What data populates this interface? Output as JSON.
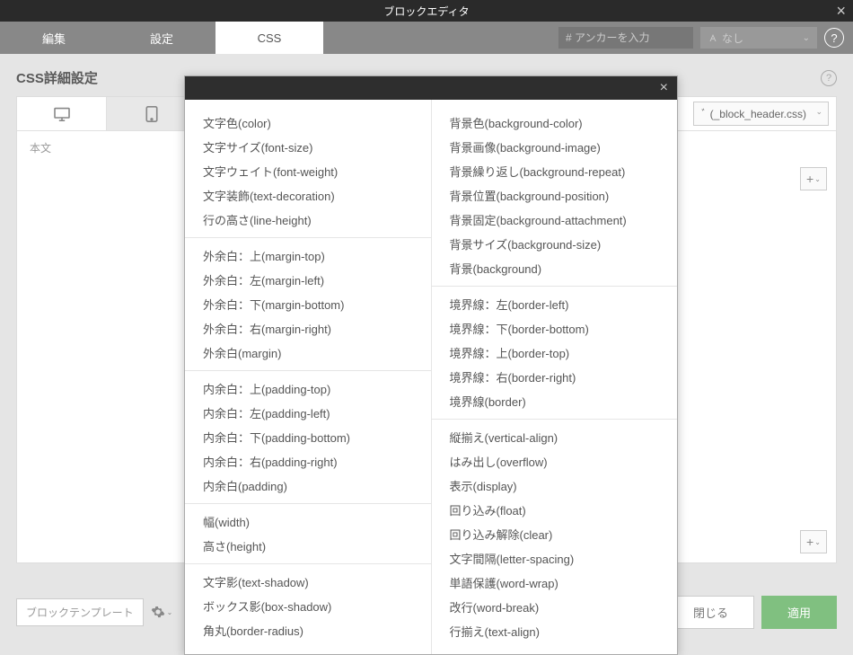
{
  "window": {
    "title": "ブロックエディタ"
  },
  "tabs": {
    "edit": "編集",
    "settings": "設定",
    "css": "CSS"
  },
  "anchor": {
    "placeholder": "# アンカーを入力"
  },
  "noneSelect": {
    "label": "なし"
  },
  "subheader": {
    "title": "CSS詳細設定"
  },
  "import": {
    "label": "ﾞ (_block_header.css)"
  },
  "body": {
    "label": "本文"
  },
  "footer": {
    "template": "ブロックテンプレート",
    "close": "閉じる",
    "apply": "適用"
  },
  "props": {
    "leftGroups": [
      [
        "文字色(color)",
        "文字サイズ(font-size)",
        "文字ウェイト(font-weight)",
        "文字装飾(text-decoration)",
        "行の高さ(line-height)"
      ],
      [
        "外余白：上(margin-top)",
        "外余白：左(margin-left)",
        "外余白：下(margin-bottom)",
        "外余白：右(margin-right)",
        "外余白(margin)"
      ],
      [
        "内余白：上(padding-top)",
        "内余白：左(padding-left)",
        "内余白：下(padding-bottom)",
        "内余白：右(padding-right)",
        "内余白(padding)"
      ],
      [
        "幅(width)",
        "高さ(height)"
      ],
      [
        "文字影(text-shadow)",
        "ボックス影(box-shadow)",
        "角丸(border-radius)"
      ]
    ],
    "rightGroups": [
      [
        "背景色(background-color)",
        "背景画像(background-image)",
        "背景繰り返し(background-repeat)",
        "背景位置(background-position)",
        "背景固定(background-attachment)",
        "背景サイズ(background-size)",
        "背景(background)"
      ],
      [
        "境界線：左(border-left)",
        "境界線：下(border-bottom)",
        "境界線：上(border-top)",
        "境界線：右(border-right)",
        "境界線(border)"
      ],
      [
        "縦揃え(vertical-align)",
        "はみ出し(overflow)",
        "表示(display)",
        "回り込み(float)",
        "回り込み解除(clear)",
        "文字間隔(letter-spacing)",
        "単語保護(word-wrap)",
        "改行(word-break)",
        "行揃え(text-align)"
      ]
    ]
  }
}
